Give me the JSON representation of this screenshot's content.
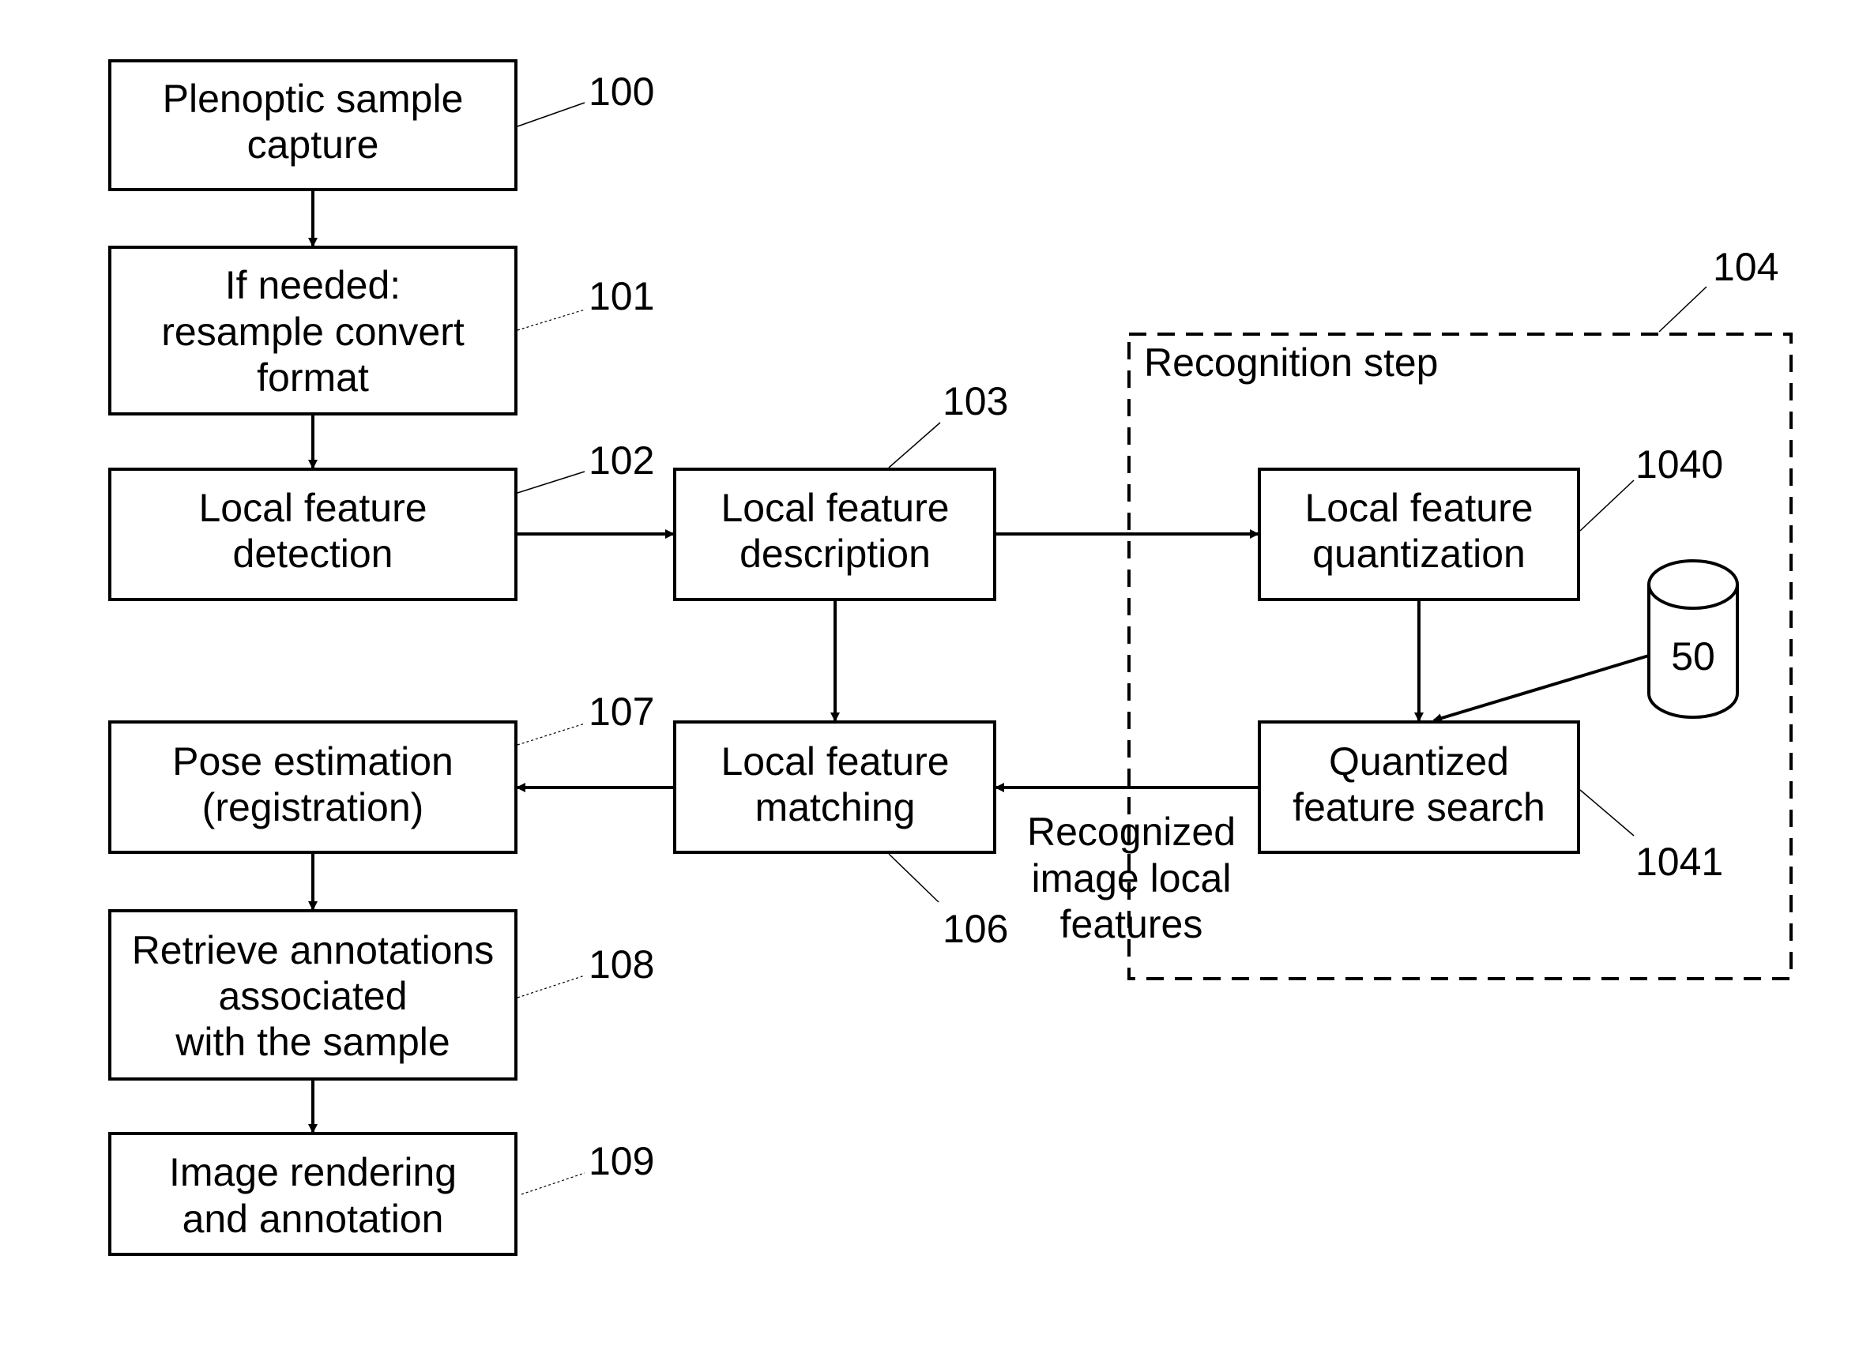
{
  "diagram": {
    "boxes": {
      "b100": {
        "ref": "100",
        "lines": [
          "Plenoptic sample",
          "capture"
        ]
      },
      "b101": {
        "ref": "101",
        "lines": [
          "If needed:",
          "resample convert",
          "format"
        ]
      },
      "b102": {
        "ref": "102",
        "lines": [
          "Local feature",
          "detection"
        ]
      },
      "b103": {
        "ref": "103",
        "lines": [
          "Local feature",
          "description"
        ]
      },
      "b1040": {
        "ref": "1040",
        "lines": [
          "Local feature",
          "quantization"
        ]
      },
      "b1041": {
        "ref": "1041",
        "lines": [
          "Quantized",
          "feature search"
        ]
      },
      "b106": {
        "ref": "106",
        "lines": [
          "Local feature",
          "matching"
        ]
      },
      "b107": {
        "ref": "107",
        "lines": [
          "Pose estimation",
          "(registration)"
        ]
      },
      "b108": {
        "ref": "108",
        "lines": [
          "Retrieve annotations",
          "associated",
          "with the sample"
        ]
      },
      "b109": {
        "ref": "109",
        "lines": [
          "Image rendering",
          "and annotation"
        ]
      }
    },
    "group": {
      "ref": "104",
      "title": "Recognition step"
    },
    "database": {
      "ref": "50"
    },
    "edge_label": {
      "lines": [
        "Recognized",
        "image local",
        "features"
      ]
    }
  }
}
